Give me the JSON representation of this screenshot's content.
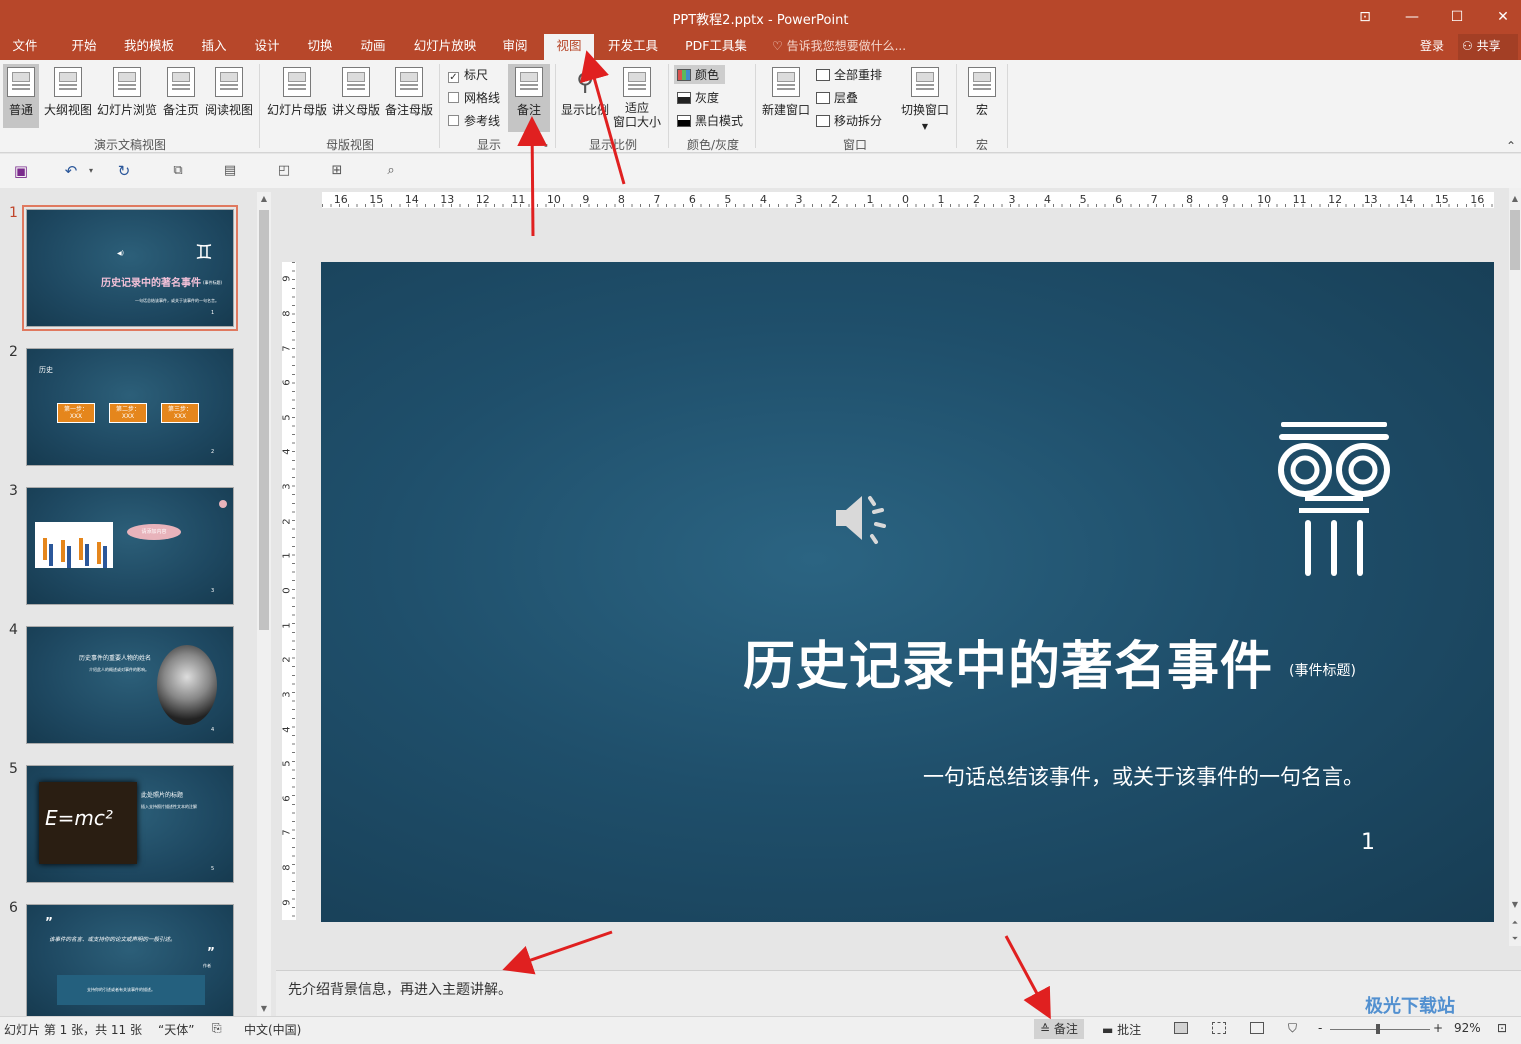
{
  "window": {
    "title": "PPT教程2.pptx - PowerPoint"
  },
  "menu": {
    "tabs": [
      "文件",
      "开始",
      "我的模板",
      "插入",
      "设计",
      "切换",
      "动画",
      "幻灯片放映",
      "审阅",
      "视图",
      "开发工具",
      "PDF工具集"
    ],
    "active": "视图",
    "tell_me": "告诉我您想要做什么...",
    "login": "登录",
    "share": "共享"
  },
  "ribbon": {
    "presentation_views": {
      "buttons": [
        "普通",
        "大纲视图",
        "幻灯片浏览",
        "备注页",
        "阅读视图"
      ],
      "group": "演示文稿视图"
    },
    "master_views": {
      "buttons": [
        "幻灯片母版",
        "讲义母版",
        "备注母版"
      ],
      "group": "母版视图"
    },
    "show": {
      "ruler": "标尺",
      "gridlines": "网格线",
      "guides": "参考线",
      "notes": "备注",
      "group": "显示",
      "ruler_checked": true
    },
    "zoom": {
      "zoom_btn": "显示比例",
      "fit_1": "适应",
      "fit_2": "窗口大小",
      "group": "显示比例"
    },
    "color": {
      "color": "颜色",
      "grayscale": "灰度",
      "bw": "黑白模式",
      "group": "颜色/灰度"
    },
    "window": {
      "new_window": "新建窗口",
      "arrange_all": "全部重排",
      "cascade": "层叠",
      "move_split": "移动拆分",
      "switch": "切换窗口",
      "group": "窗口"
    },
    "macros": {
      "macro": "宏",
      "group": "宏"
    }
  },
  "ruler": {
    "horizontal": [
      "16",
      "15",
      "14",
      "13",
      "12",
      "11",
      "10",
      "9",
      "8",
      "7",
      "6",
      "5",
      "4",
      "3",
      "2",
      "1",
      "0",
      "1",
      "2",
      "3",
      "4",
      "5",
      "6",
      "7",
      "8",
      "9",
      "10",
      "11",
      "12",
      "13",
      "14",
      "15",
      "16"
    ],
    "vertical": [
      "9",
      "8",
      "7",
      "6",
      "5",
      "4",
      "3",
      "2",
      "1",
      "0",
      "1",
      "2",
      "3",
      "4",
      "5",
      "6",
      "7",
      "8",
      "9"
    ]
  },
  "thumbnails": [
    {
      "num": "1",
      "title": "历史记录中的著名事件",
      "tag": "(事件标题)",
      "sub": "一句话总结该事件，或关于该事件的一句名言。",
      "page": "1"
    },
    {
      "num": "2",
      "title": "历史",
      "steps": [
        "第一步：",
        "第二步：",
        "第三步："
      ],
      "step_text": "XXX",
      "page": "2"
    },
    {
      "num": "3",
      "bubble": "请添加内容",
      "page": "3"
    },
    {
      "num": "4",
      "title": "历史事件的重要人物的姓名",
      "sub": "介绍此人的概述或对事件的影响。",
      "page": "4"
    },
    {
      "num": "5",
      "title": "此处照片的标题",
      "formula": "E=mc²",
      "sub": "插入支持照片描述性文本的注解",
      "page": "5"
    },
    {
      "num": "6",
      "quote": "该事件的名言、或支持你的论文或声明的一般引述。",
      "author": "作者",
      "sub": "支持你的引述或者有关该事件的描述。",
      "page": "6"
    }
  ],
  "slide": {
    "title": "历史记录中的著名事件",
    "tag": "(事件标题)",
    "subtitle": "一句话总结该事件，或关于该事件的一句名言。",
    "number": "1"
  },
  "notes": {
    "text": "先介绍背景信息，再进入主题讲解。"
  },
  "status": {
    "slide_info": "幻灯片 第 1 张，共 11 张",
    "theme": "“天体”",
    "language": "中文(中国)",
    "notes_btn": "备注",
    "comments_btn": "批注",
    "zoom": "92%"
  },
  "watermark": "极光下载站"
}
